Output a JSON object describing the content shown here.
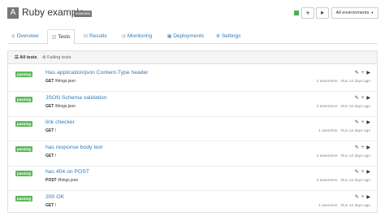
{
  "header": {
    "avatar_letter": "A",
    "title": "Ruby example",
    "badge": "essential",
    "status_color": "#4caf50",
    "add_label": "+",
    "run_label": "▶",
    "env_label": "All environments"
  },
  "tabs": [
    {
      "label": "Overview",
      "icon": "overview-icon"
    },
    {
      "label": "Tests",
      "icon": "tests-icon"
    },
    {
      "label": "Results",
      "icon": "results-icon"
    },
    {
      "label": "Monitoring",
      "icon": "monitoring-icon"
    },
    {
      "label": "Deployments",
      "icon": "deployments-icon"
    },
    {
      "label": "Settings",
      "icon": "settings-icon"
    }
  ],
  "subnav": {
    "all": "All tests",
    "failing": "Failing tests"
  },
  "tests": [
    {
      "status": "passing",
      "name": "Has application/json Content-Type header",
      "method": "GET",
      "path": "/things.json",
      "assertions": "2 assertions",
      "run": "Run 12 days ago"
    },
    {
      "status": "passing",
      "name": "JSON Schema validation",
      "method": "GET",
      "path": "/things.json",
      "assertions": "2 assertions",
      "run": "Run 10 days ago"
    },
    {
      "status": "passing",
      "name": "link checker",
      "method": "GET",
      "path": "/",
      "assertions": "1 assertion",
      "run": "Run 12 days ago"
    },
    {
      "status": "passing",
      "name": "has response body text",
      "method": "GET",
      "path": "/",
      "assertions": "2 assertions",
      "run": "Run 12 days ago"
    },
    {
      "status": "passing",
      "name": "has 404 on POST",
      "method": "POST",
      "path": "/things.json",
      "assertions": "2 assertions",
      "run": "Run 12 days ago"
    },
    {
      "status": "passing",
      "name": "200 OK",
      "method": "GET",
      "path": "/",
      "assertions": "1 assertion",
      "run": "Run 12 days ago"
    }
  ],
  "colors": {
    "passing": "#5cb85c",
    "link": "#337ab7"
  }
}
